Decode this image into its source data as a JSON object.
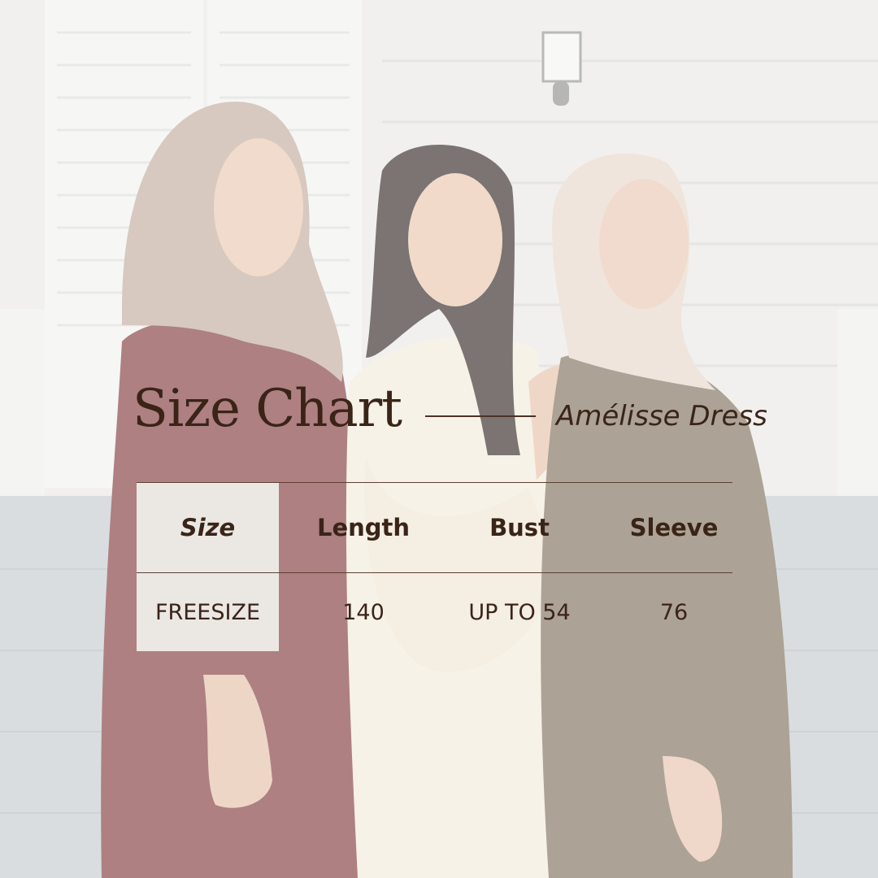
{
  "title": "Size Chart",
  "subtitle": "Amélisse Dress",
  "table": {
    "headers": [
      "Size",
      "Length",
      "Bust",
      "Sleeve"
    ],
    "rows": [
      [
        "FREESIZE",
        "140",
        "UP TO 54",
        "76"
      ]
    ]
  },
  "colors": {
    "text": "#3a2418",
    "size_column_bg": "#ebe8e4",
    "background": "#e9e6e1",
    "dress_maroon": "#7d3236",
    "dress_cream": "#f3ead8",
    "dress_olive": "#7a6a55"
  }
}
